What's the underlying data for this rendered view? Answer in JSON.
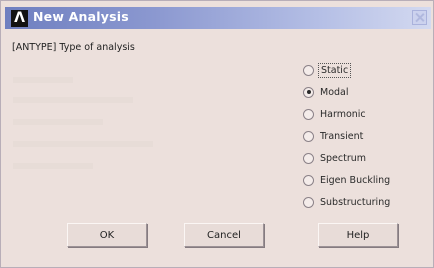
{
  "window": {
    "title": "New Analysis",
    "logo_text": "Λ"
  },
  "heading": "[ANTYPE]  Type of analysis",
  "analysis_types": [
    {
      "label": "Static",
      "checked": false
    },
    {
      "label": "Modal",
      "checked": true
    },
    {
      "label": "Harmonic",
      "checked": false
    },
    {
      "label": "Transient",
      "checked": false
    },
    {
      "label": "Spectrum",
      "checked": false
    },
    {
      "label": "Eigen Buckling",
      "checked": false
    },
    {
      "label": "Substructuring",
      "checked": false
    }
  ],
  "buttons": {
    "ok": "OK",
    "cancel": "Cancel",
    "help": "Help"
  }
}
